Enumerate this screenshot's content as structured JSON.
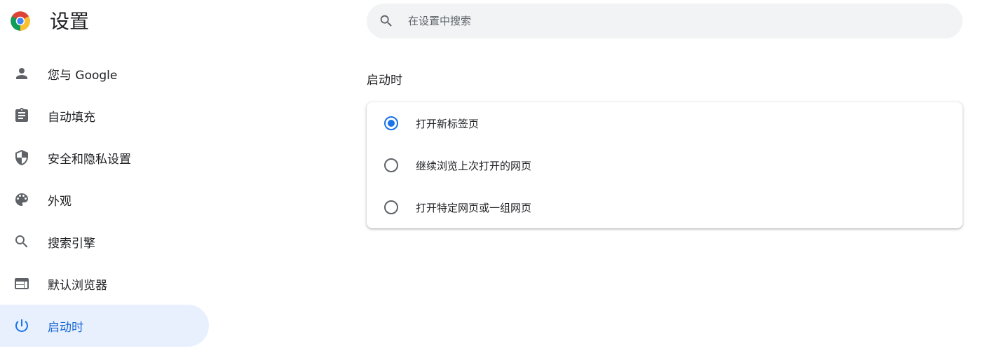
{
  "app": {
    "title": "设置",
    "logo_icon": "chrome-logo"
  },
  "search": {
    "placeholder": "在设置中搜索",
    "value": "",
    "icon": "search-icon"
  },
  "sidebar": {
    "items": [
      {
        "label": "您与 Google",
        "icon": "person-icon",
        "active": false
      },
      {
        "label": "自动填充",
        "icon": "clipboard-icon",
        "active": false
      },
      {
        "label": "安全和隐私设置",
        "icon": "shield-icon",
        "active": false
      },
      {
        "label": "外观",
        "icon": "palette-icon",
        "active": false
      },
      {
        "label": "搜索引擎",
        "icon": "search-icon",
        "active": false
      },
      {
        "label": "默认浏览器",
        "icon": "browser-icon",
        "active": false
      },
      {
        "label": "启动时",
        "icon": "power-icon",
        "active": true
      }
    ]
  },
  "main": {
    "section_title": "启动时",
    "options": [
      {
        "label": "打开新标签页",
        "checked": true
      },
      {
        "label": "继续浏览上次打开的网页",
        "checked": false
      },
      {
        "label": "打开特定网页或一组网页",
        "checked": false
      }
    ]
  },
  "colors": {
    "accent": "#1a73e8",
    "active_bg": "#e8f0fe",
    "search_bg": "#f1f3f4",
    "icon_gray": "#5f6368"
  }
}
